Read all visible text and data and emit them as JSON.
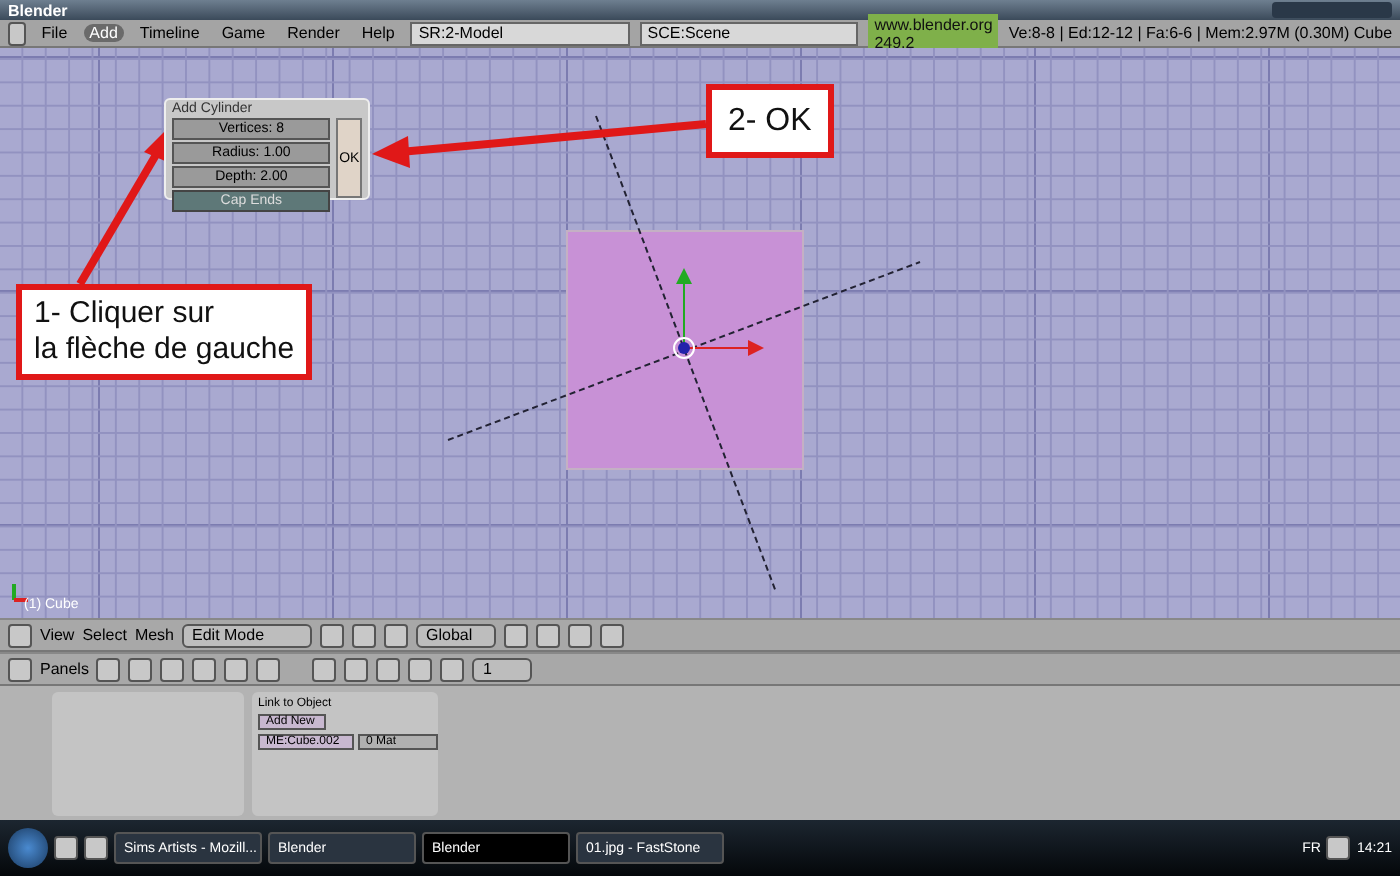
{
  "window": {
    "title": "Blender"
  },
  "menu": {
    "items": [
      {
        "label": "File",
        "selected": false
      },
      {
        "label": "Add",
        "selected": true
      },
      {
        "label": "Timeline",
        "selected": false
      },
      {
        "label": "Game",
        "selected": false
      },
      {
        "label": "Render",
        "selected": false
      },
      {
        "label": "Help",
        "selected": false
      }
    ],
    "screen_field": "SR:2-Model",
    "scene_field": "SCE:Scene",
    "website": "www.blender.org 249.2",
    "stats": "Ve:8-8 | Ed:12-12 | Fa:6-6 | Mem:2.97M (0.30M) Cube"
  },
  "viewport": {
    "object_label": "(1) Cube"
  },
  "add_cylinder": {
    "title": "Add Cylinder",
    "fields": [
      "Vertices: 8",
      "Radius: 1.00",
      "Depth: 2.00"
    ],
    "toggle": {
      "label": "Cap Ends",
      "on": true
    },
    "ok": "OK"
  },
  "callouts": [
    {
      "lines": [
        "2- OK"
      ]
    },
    {
      "lines": [
        "1- Cliquer sur",
        "la flèche de gauche"
      ]
    }
  ],
  "view_header": {
    "menus": [
      "View",
      "Select",
      "Mesh"
    ],
    "mode": "Edit Mode",
    "orientation": "Global"
  },
  "buttons_header": {
    "label": "Panels",
    "frame": "1"
  },
  "buttons_panel": {
    "title": "Link to Object",
    "add_new": "Add New",
    "mesh_name": "ME:Cube.002",
    "materials": "0 Mat"
  },
  "taskbar": {
    "tasks": [
      {
        "label": "Sims Artists - Mozill...",
        "selected": false
      },
      {
        "label": "Blender",
        "selected": false
      },
      {
        "label": "Blender",
        "selected": true
      },
      {
        "label": "01.jpg - FastStone",
        "selected": false
      }
    ],
    "language": "FR",
    "clock": "14:21"
  }
}
